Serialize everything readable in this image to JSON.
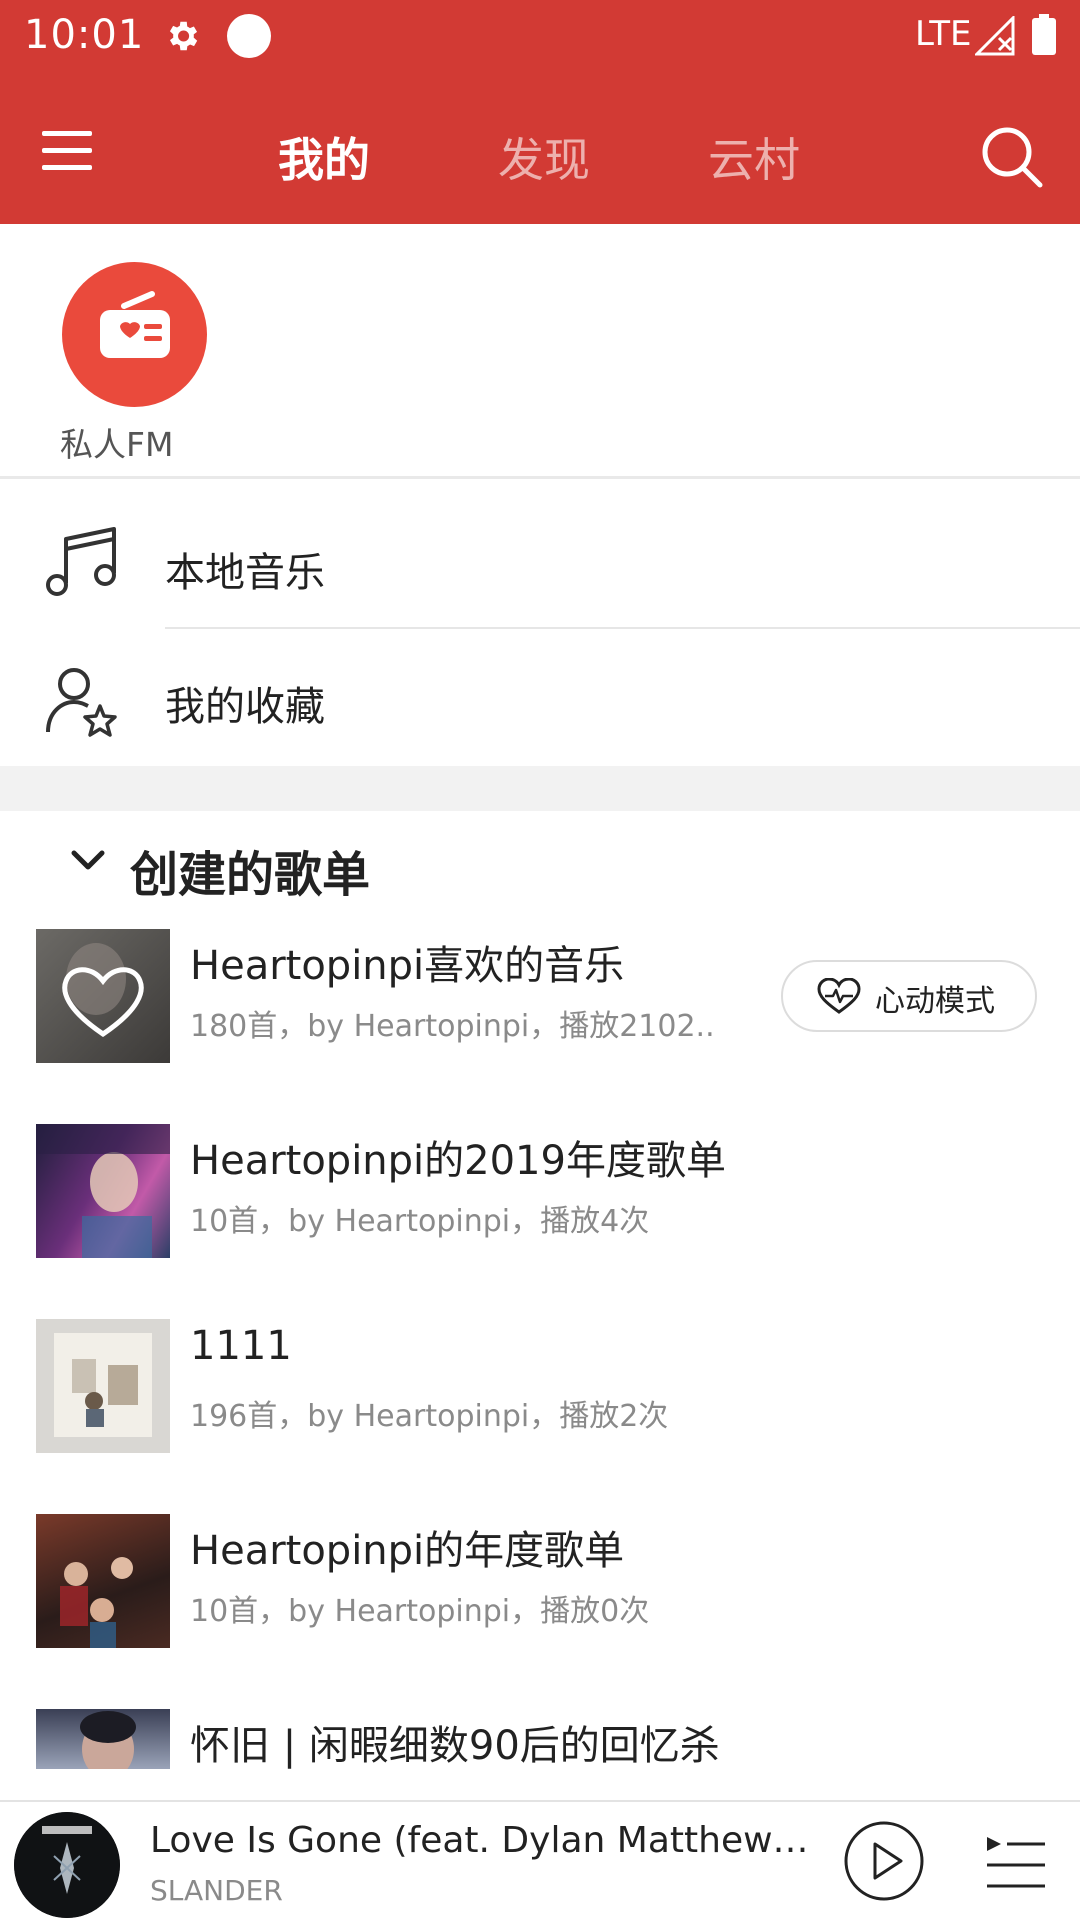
{
  "status": {
    "time": "10:01",
    "network": "LTE"
  },
  "header": {
    "tabs": [
      "我的",
      "发现",
      "云村"
    ],
    "accent": "#d23a34"
  },
  "fm": {
    "label": "私人FM"
  },
  "menu": [
    {
      "label": "本地音乐",
      "icon": "music-note-icon"
    },
    {
      "label": "我的收藏",
      "icon": "user-star-icon"
    }
  ],
  "section": {
    "title": "创建的歌单"
  },
  "playlists": [
    {
      "title": "Heartopinpi喜欢的音乐",
      "subtitle": "180首，by Heartopinpi，播放2102.."
    },
    {
      "title": "Heartopinpi的2019年度歌单",
      "subtitle": "10首，by Heartopinpi，播放4次"
    },
    {
      "title": "1111",
      "subtitle": "196首，by Heartopinpi，播放2次"
    },
    {
      "title": "Heartopinpi的年度歌单",
      "subtitle": "10首，by Heartopinpi，播放0次"
    },
    {
      "title": "怀旧 | 闲暇细数90后的回忆杀",
      "subtitle": ""
    }
  ],
  "heart_mode": {
    "label": "心动模式"
  },
  "player": {
    "title": "Love Is Gone (feat. Dylan Matthew) (Ac...",
    "artist": "SLANDER"
  }
}
